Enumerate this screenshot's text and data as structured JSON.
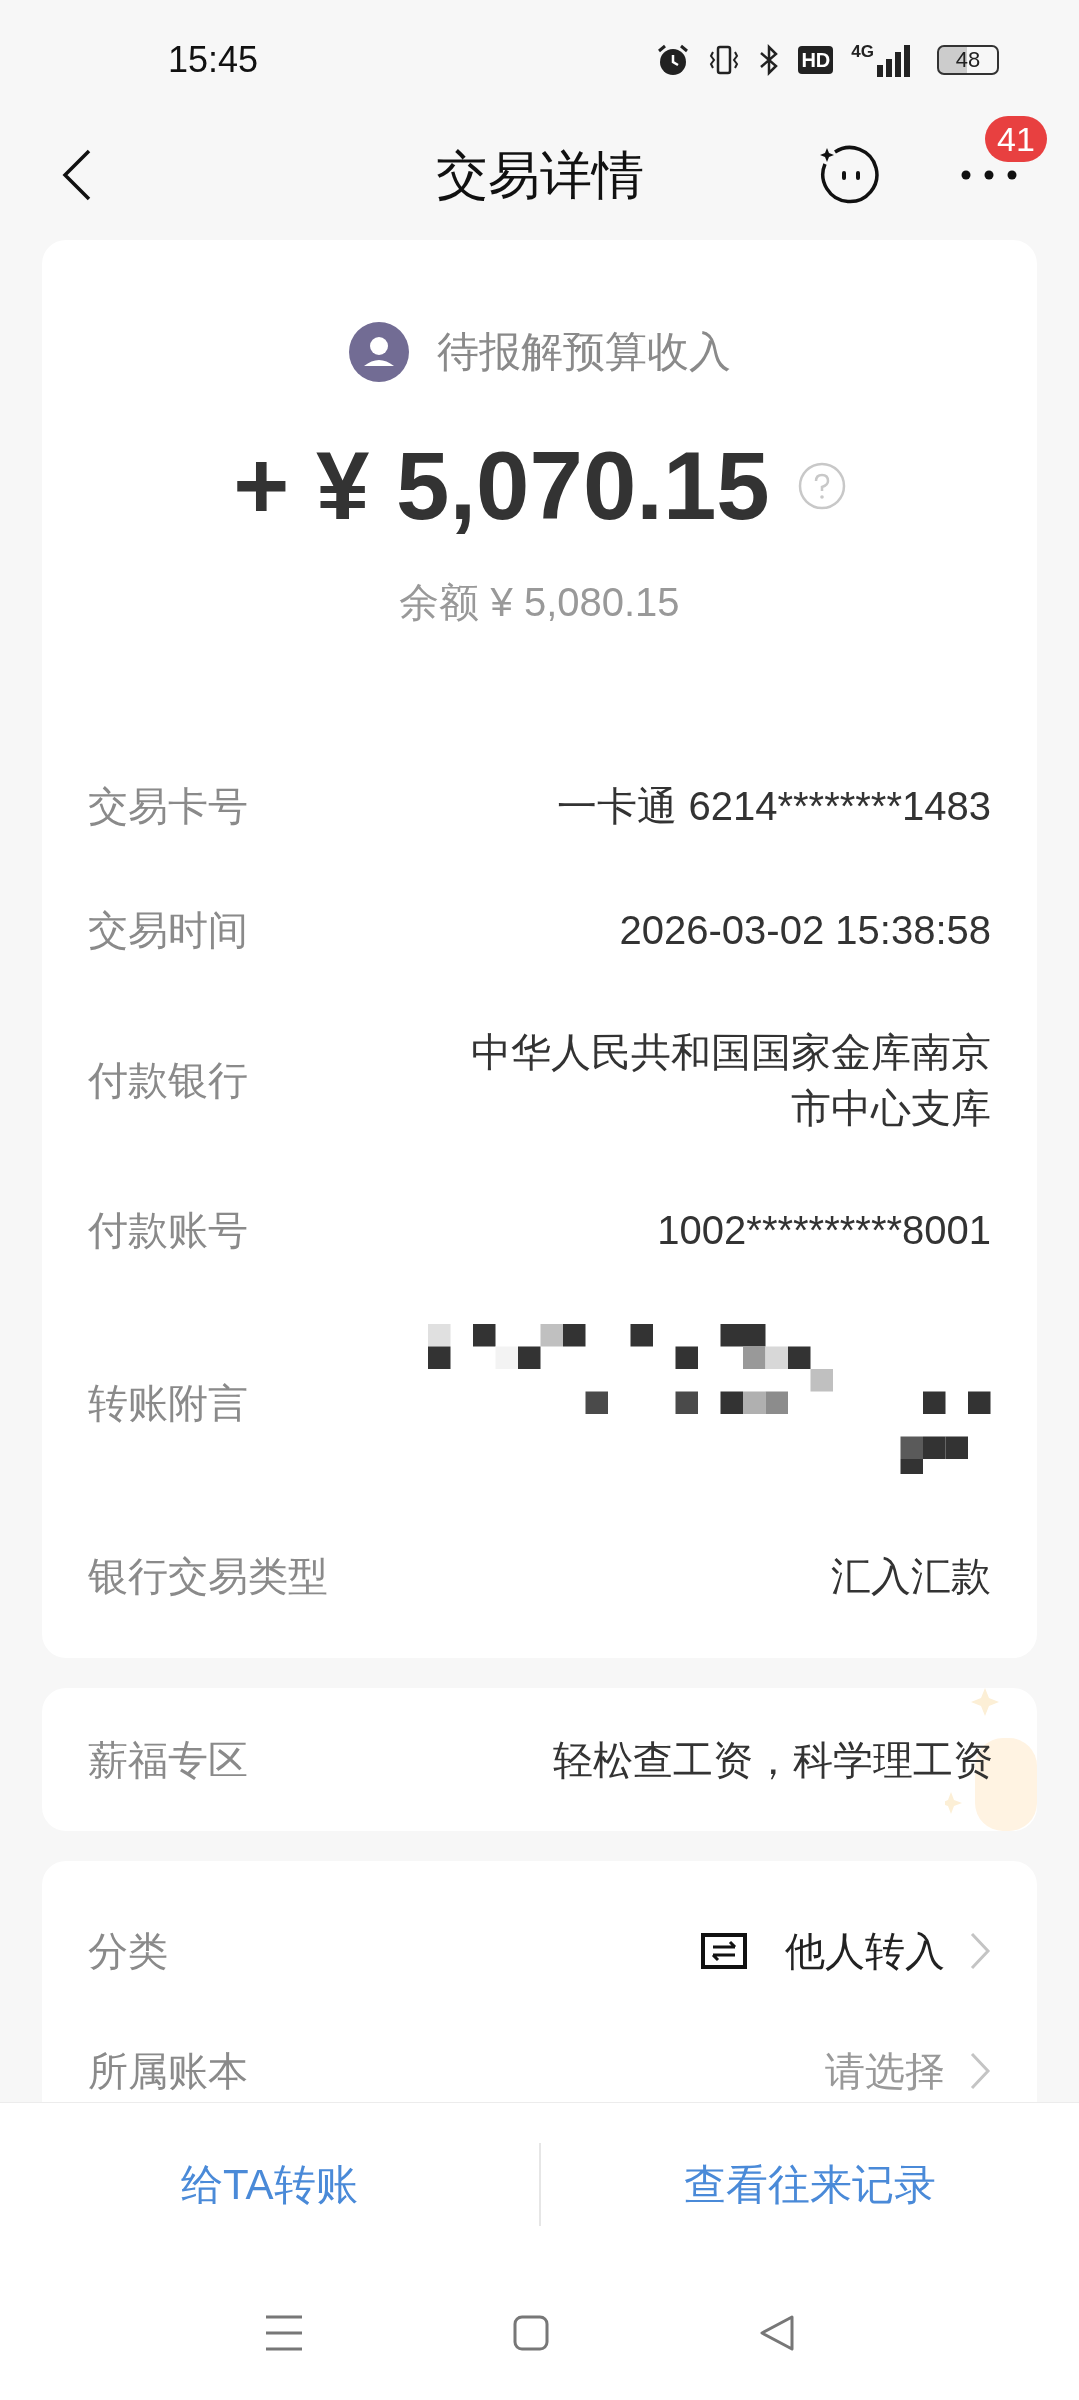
{
  "status_bar": {
    "time": "15:45",
    "hd": "HD",
    "network": "4G",
    "battery": "48"
  },
  "header": {
    "title": "交易详情",
    "badge": "41"
  },
  "summary": {
    "type_label": "待报解预算收入",
    "sign": "+",
    "currency": "¥",
    "amount": "5,070.15",
    "balance": "余额 ¥ 5,080.15"
  },
  "details": [
    {
      "label": "交易卡号",
      "kind": "text",
      "value": "一卡通 6214********1483"
    },
    {
      "label": "交易时间",
      "kind": "text",
      "value": "2026-03-02 15:38:58"
    },
    {
      "label": "付款银行",
      "kind": "text",
      "value": "中华人民共和国国家金库南京市中心支库"
    },
    {
      "label": "付款账号",
      "kind": "text",
      "value": "1002**********8001"
    },
    {
      "label": "转账附言",
      "kind": "mosaic"
    },
    {
      "label": "银行交易类型",
      "kind": "text",
      "value": "汇入汇款"
    }
  ],
  "promo": {
    "label": "薪福专区",
    "value": "轻松查工资，科学理工资"
  },
  "settings": [
    {
      "label": "分类",
      "kind": "category",
      "value": "他人转入"
    },
    {
      "label": "所属账本",
      "kind": "placeholder",
      "value": "请选择"
    }
  ],
  "actions": [
    "给TA转账",
    "查看往来记录"
  ]
}
